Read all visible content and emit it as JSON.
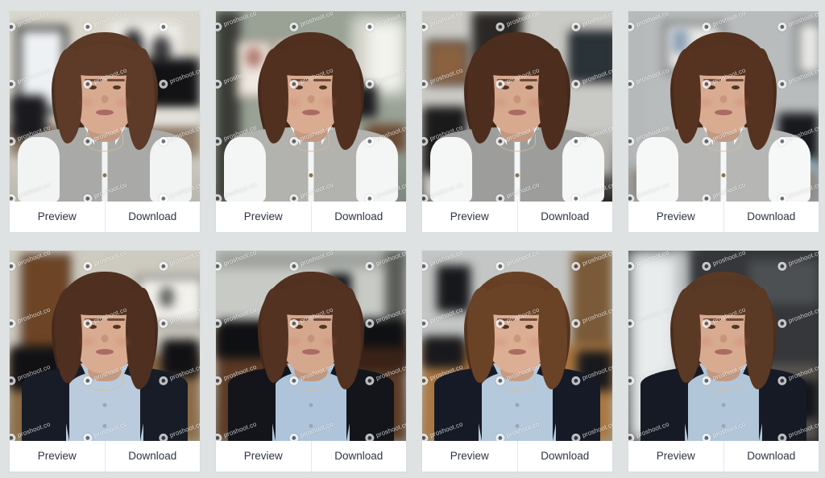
{
  "page": {
    "background_color": "#dfe2e2",
    "card_background": "#ffffff",
    "text_color": "#2f3542",
    "divider_color": "#e6e8ea"
  },
  "watermark": {
    "text": "proshoot.co",
    "icon": "proshoot-badge-icon",
    "rotation_deg": -20,
    "color": "#ffffff"
  },
  "actions": {
    "preview_label": "Preview",
    "download_label": "Download"
  },
  "grid": {
    "columns": 4,
    "rows": 2,
    "total_cards": 8
  },
  "cards": [
    {
      "id": "headshot-1",
      "alt": "Woman in gray vest and white shirt, home office with monitor and window",
      "outfit": "gray-vest-white-shirt",
      "scene": "home-office-monitor",
      "colors": {
        "wall": "#d9d7cd",
        "wall_shadow": "#b9b7ad",
        "accent": "#1b1b1e",
        "floor": "#8d7a66",
        "vest": "#a9aaa7",
        "shirt": "#f2f3f3",
        "hair": "#5d3b28",
        "skin": "#d8ab91"
      }
    },
    {
      "id": "headshot-2",
      "alt": "Woman in gray button vest with arms crossed, office with abstract art and window",
      "outfit": "gray-vest-white-shirt",
      "scene": "office-abstract-art",
      "colors": {
        "wall": "#9aa296",
        "wall_shadow": "#7e8880",
        "accent": "#c79a86",
        "floor": "#6b4a33",
        "vest": "#b2b2ae",
        "shirt": "#f4f5f5",
        "hair": "#51301f",
        "skin": "#d9ab90"
      }
    },
    {
      "id": "headshot-3",
      "alt": "Woman in gray vest and white shirt, wall with framed photographs",
      "outfit": "gray-vest-white-shirt",
      "scene": "gallery-wall-hallway",
      "colors": {
        "wall": "#c9c9c5",
        "wall_shadow": "#2a2724",
        "accent": "#3a3a3c",
        "floor": "#1d1c1c",
        "vest": "#9d9e9c",
        "shirt": "#f5f6f6",
        "hair": "#4d2e1e",
        "skin": "#d7a98e"
      }
    },
    {
      "id": "headshot-4",
      "alt": "Woman in gray vest, arms crossed, gray wall with two framed prints and monitor",
      "outfit": "gray-vest-white-shirt",
      "scene": "gray-wall-framed-prints",
      "colors": {
        "wall": "#b9bcbd",
        "wall_shadow": "#9a9ea0",
        "accent": "#3d4043",
        "floor": "#8f8b86",
        "vest": "#b6b7b5",
        "shirt": "#f6f7f7",
        "hair": "#553320",
        "skin": "#d9ac92"
      }
    },
    {
      "id": "headshot-5",
      "alt": "Woman in navy blazer and light blue shirt, wooden door and conference table",
      "outfit": "navy-blazer-blue-shirt",
      "scene": "conference-room-wood-door",
      "colors": {
        "wall": "#cdcabf",
        "wall_shadow": "#a49d90",
        "accent": "#6b4124",
        "floor": "#8a6a46",
        "blazer": "#181c27",
        "shirt": "#b9cbdd",
        "hair": "#4f3020",
        "skin": "#d9ab90"
      }
    },
    {
      "id": "headshot-6",
      "alt": "Woman in black blazer and blue shirt seated at long boardroom table",
      "outfit": "navy-blazer-blue-shirt",
      "scene": "boardroom-dark-table",
      "colors": {
        "wall": "#c8cac6",
        "wall_shadow": "#8e938f",
        "accent": "#14161a",
        "floor": "#5b3a24",
        "blazer": "#13151b",
        "shirt": "#aec4da",
        "hair": "#533221",
        "skin": "#d5a88d"
      }
    },
    {
      "id": "headshot-7",
      "alt": "Woman in navy blazer and blue shirt at light wood table with wall TV",
      "outfit": "navy-blazer-blue-shirt",
      "scene": "meeting-room-wood-table-tv",
      "colors": {
        "wall": "#c4c6c5",
        "wall_shadow": "#9fa2a1",
        "accent": "#1a1a1c",
        "floor": "#a9763f",
        "blazer": "#161a26",
        "shirt": "#b5c9dd",
        "hair": "#6a4226",
        "skin": "#dcae93"
      }
    },
    {
      "id": "headshot-8",
      "alt": "Woman in navy blazer with arms crossed, bright window and dark wall",
      "outfit": "navy-blazer-blue-shirt",
      "scene": "office-bright-window",
      "colors": {
        "wall": "#35373a",
        "wall_shadow": "#202225",
        "accent": "#e9eced",
        "floor": "#4a4c4f",
        "blazer": "#161a24",
        "shirt": "#b2c6da",
        "hair": "#5a3a25",
        "skin": "#d8aa8f"
      }
    }
  ]
}
